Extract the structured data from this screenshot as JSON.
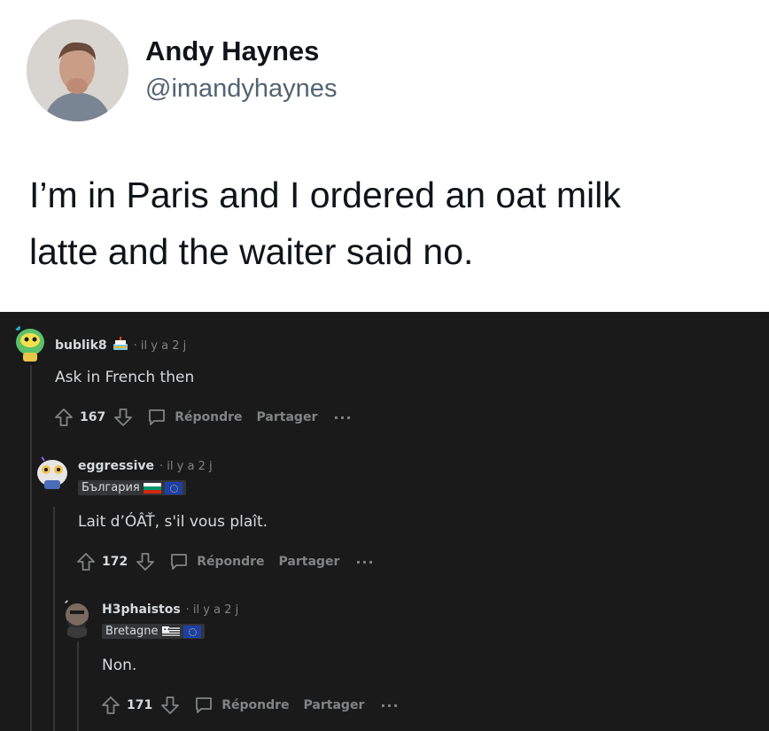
{
  "tweet": {
    "author_name": "Andy Haynes",
    "handle": "@imandyhaynes",
    "text_line1": "I’m in Paris and I ordered an oat milk",
    "text_line2": "latte and the waiter said no."
  },
  "comments": [
    {
      "username": "bublik8",
      "cake_icon": "cake-day-icon",
      "time": "· il y a 2 j",
      "body": "Ask in French then",
      "score": "167",
      "reply_label": "Répondre",
      "share_label": "Partager",
      "more_label": "···"
    },
    {
      "username": "eggressive",
      "time": "· il y a 2 j",
      "flair": "България",
      "body": "Lait d’ÓÂŤ, s'il vous plaît.",
      "score": "172",
      "reply_label": "Répondre",
      "share_label": "Partager",
      "more_label": "···"
    },
    {
      "username": "H3phaistos",
      "time": "· il y a 2 j",
      "flair": "Bretagne",
      "body": "Non.",
      "score": "171",
      "reply_label": "Répondre",
      "share_label": "Partager",
      "more_label": "···"
    }
  ],
  "colors": {
    "thread_bg": "#1a1a1b",
    "meta_gray": "#818384",
    "text_light": "#d7dadc"
  }
}
